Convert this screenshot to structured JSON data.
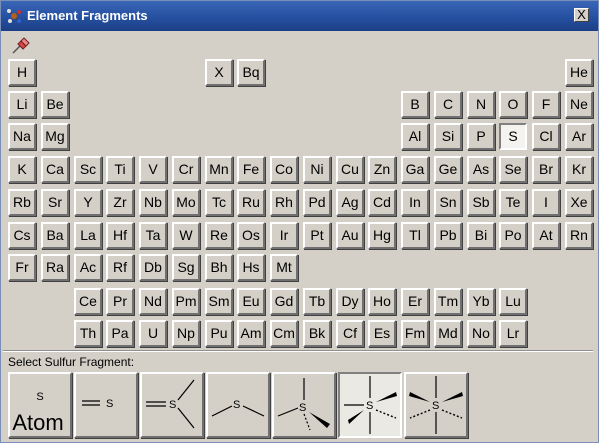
{
  "window": {
    "title": "Element Fragments",
    "close_label": "X"
  },
  "elements": [
    {
      "symbol": "H",
      "row": 0,
      "col": 0
    },
    {
      "symbol": "X",
      "row": 0,
      "col": 6
    },
    {
      "symbol": "Bq",
      "row": 0,
      "col": 7
    },
    {
      "symbol": "He",
      "row": 0,
      "col": 17
    },
    {
      "symbol": "Li",
      "row": 1,
      "col": 0
    },
    {
      "symbol": "Be",
      "row": 1,
      "col": 1
    },
    {
      "symbol": "B",
      "row": 1,
      "col": 12
    },
    {
      "symbol": "C",
      "row": 1,
      "col": 13
    },
    {
      "symbol": "N",
      "row": 1,
      "col": 14
    },
    {
      "symbol": "O",
      "row": 1,
      "col": 15
    },
    {
      "symbol": "F",
      "row": 1,
      "col": 16
    },
    {
      "symbol": "Ne",
      "row": 1,
      "col": 17
    },
    {
      "symbol": "Na",
      "row": 2,
      "col": 0
    },
    {
      "symbol": "Mg",
      "row": 2,
      "col": 1
    },
    {
      "symbol": "Al",
      "row": 2,
      "col": 12
    },
    {
      "symbol": "Si",
      "row": 2,
      "col": 13
    },
    {
      "symbol": "P",
      "row": 2,
      "col": 14
    },
    {
      "symbol": "S",
      "row": 2,
      "col": 15,
      "selected": true
    },
    {
      "symbol": "Cl",
      "row": 2,
      "col": 16
    },
    {
      "symbol": "Ar",
      "row": 2,
      "col": 17
    },
    {
      "symbol": "K",
      "row": 3,
      "col": 0
    },
    {
      "symbol": "Ca",
      "row": 3,
      "col": 1
    },
    {
      "symbol": "Sc",
      "row": 3,
      "col": 2
    },
    {
      "symbol": "Ti",
      "row": 3,
      "col": 3
    },
    {
      "symbol": "V",
      "row": 3,
      "col": 4
    },
    {
      "symbol": "Cr",
      "row": 3,
      "col": 5
    },
    {
      "symbol": "Mn",
      "row": 3,
      "col": 6
    },
    {
      "symbol": "Fe",
      "row": 3,
      "col": 7
    },
    {
      "symbol": "Co",
      "row": 3,
      "col": 8
    },
    {
      "symbol": "Ni",
      "row": 3,
      "col": 9
    },
    {
      "symbol": "Cu",
      "row": 3,
      "col": 10
    },
    {
      "symbol": "Zn",
      "row": 3,
      "col": 11
    },
    {
      "symbol": "Ga",
      "row": 3,
      "col": 12
    },
    {
      "symbol": "Ge",
      "row": 3,
      "col": 13
    },
    {
      "symbol": "As",
      "row": 3,
      "col": 14
    },
    {
      "symbol": "Se",
      "row": 3,
      "col": 15
    },
    {
      "symbol": "Br",
      "row": 3,
      "col": 16
    },
    {
      "symbol": "Kr",
      "row": 3,
      "col": 17
    },
    {
      "symbol": "Rb",
      "row": 4,
      "col": 0
    },
    {
      "symbol": "Sr",
      "row": 4,
      "col": 1
    },
    {
      "symbol": "Y",
      "row": 4,
      "col": 2
    },
    {
      "symbol": "Zr",
      "row": 4,
      "col": 3
    },
    {
      "symbol": "Nb",
      "row": 4,
      "col": 4
    },
    {
      "symbol": "Mo",
      "row": 4,
      "col": 5
    },
    {
      "symbol": "Tc",
      "row": 4,
      "col": 6
    },
    {
      "symbol": "Ru",
      "row": 4,
      "col": 7
    },
    {
      "symbol": "Rh",
      "row": 4,
      "col": 8
    },
    {
      "symbol": "Pd",
      "row": 4,
      "col": 9
    },
    {
      "symbol": "Ag",
      "row": 4,
      "col": 10
    },
    {
      "symbol": "Cd",
      "row": 4,
      "col": 11
    },
    {
      "symbol": "In",
      "row": 4,
      "col": 12
    },
    {
      "symbol": "Sn",
      "row": 4,
      "col": 13
    },
    {
      "symbol": "Sb",
      "row": 4,
      "col": 14
    },
    {
      "symbol": "Te",
      "row": 4,
      "col": 15
    },
    {
      "symbol": "I",
      "row": 4,
      "col": 16
    },
    {
      "symbol": "Xe",
      "row": 4,
      "col": 17
    },
    {
      "symbol": "Cs",
      "row": 5,
      "col": 0
    },
    {
      "symbol": "Ba",
      "row": 5,
      "col": 1
    },
    {
      "symbol": "La",
      "row": 5,
      "col": 2
    },
    {
      "symbol": "Hf",
      "row": 5,
      "col": 3
    },
    {
      "symbol": "Ta",
      "row": 5,
      "col": 4
    },
    {
      "symbol": "W",
      "row": 5,
      "col": 5
    },
    {
      "symbol": "Re",
      "row": 5,
      "col": 6
    },
    {
      "symbol": "Os",
      "row": 5,
      "col": 7
    },
    {
      "symbol": "Ir",
      "row": 5,
      "col": 8
    },
    {
      "symbol": "Pt",
      "row": 5,
      "col": 9
    },
    {
      "symbol": "Au",
      "row": 5,
      "col": 10
    },
    {
      "symbol": "Hg",
      "row": 5,
      "col": 11
    },
    {
      "symbol": "Tl",
      "row": 5,
      "col": 12
    },
    {
      "symbol": "Pb",
      "row": 5,
      "col": 13
    },
    {
      "symbol": "Bi",
      "row": 5,
      "col": 14
    },
    {
      "symbol": "Po",
      "row": 5,
      "col": 15
    },
    {
      "symbol": "At",
      "row": 5,
      "col": 16
    },
    {
      "symbol": "Rn",
      "row": 5,
      "col": 17
    },
    {
      "symbol": "Fr",
      "row": 6,
      "col": 0
    },
    {
      "symbol": "Ra",
      "row": 6,
      "col": 1
    },
    {
      "symbol": "Ac",
      "row": 6,
      "col": 2
    },
    {
      "symbol": "Rf",
      "row": 6,
      "col": 3
    },
    {
      "symbol": "Db",
      "row": 6,
      "col": 4
    },
    {
      "symbol": "Sg",
      "row": 6,
      "col": 5
    },
    {
      "symbol": "Bh",
      "row": 6,
      "col": 6
    },
    {
      "symbol": "Hs",
      "row": 6,
      "col": 7
    },
    {
      "symbol": "Mt",
      "row": 6,
      "col": 8
    },
    {
      "symbol": "Ce",
      "row": 7,
      "col": 2
    },
    {
      "symbol": "Pr",
      "row": 7,
      "col": 3
    },
    {
      "symbol": "Nd",
      "row": 7,
      "col": 4
    },
    {
      "symbol": "Pm",
      "row": 7,
      "col": 5
    },
    {
      "symbol": "Sm",
      "row": 7,
      "col": 6
    },
    {
      "symbol": "Eu",
      "row": 7,
      "col": 7
    },
    {
      "symbol": "Gd",
      "row": 7,
      "col": 8
    },
    {
      "symbol": "Tb",
      "row": 7,
      "col": 9
    },
    {
      "symbol": "Dy",
      "row": 7,
      "col": 10
    },
    {
      "symbol": "Ho",
      "row": 7,
      "col": 11
    },
    {
      "symbol": "Er",
      "row": 7,
      "col": 12
    },
    {
      "symbol": "Tm",
      "row": 7,
      "col": 13
    },
    {
      "symbol": "Yb",
      "row": 7,
      "col": 14
    },
    {
      "symbol": "Lu",
      "row": 7,
      "col": 15
    },
    {
      "symbol": "Th",
      "row": 8,
      "col": 2
    },
    {
      "symbol": "Pa",
      "row": 8,
      "col": 3
    },
    {
      "symbol": "U",
      "row": 8,
      "col": 4
    },
    {
      "symbol": "Np",
      "row": 8,
      "col": 5
    },
    {
      "symbol": "Pu",
      "row": 8,
      "col": 6
    },
    {
      "symbol": "Am",
      "row": 8,
      "col": 7
    },
    {
      "symbol": "Cm",
      "row": 8,
      "col": 8
    },
    {
      "symbol": "Bk",
      "row": 8,
      "col": 9
    },
    {
      "symbol": "Cf",
      "row": 8,
      "col": 10
    },
    {
      "symbol": "Es",
      "row": 8,
      "col": 11
    },
    {
      "symbol": "Fm",
      "row": 8,
      "col": 12
    },
    {
      "symbol": "Md",
      "row": 8,
      "col": 13
    },
    {
      "symbol": "No",
      "row": 8,
      "col": 14
    },
    {
      "symbol": "Lr",
      "row": 8,
      "col": 15
    }
  ],
  "fragment_panel": {
    "label": "Select Sulfur Fragment:",
    "atom_symbol": "S",
    "atom_label": "Atom",
    "fragments": [
      {
        "name": "fragment-atom",
        "selected": false
      },
      {
        "name": "fragment-double-bond",
        "atom": "S",
        "selected": false
      },
      {
        "name": "fragment-double-bond-two-bonds",
        "atom": "S",
        "selected": false
      },
      {
        "name": "fragment-two-bonds",
        "atom": "S",
        "selected": false
      },
      {
        "name": "fragment-pyramidal-three-bonds",
        "atom": "S",
        "selected": false
      },
      {
        "name": "fragment-octahedral",
        "atom": "S",
        "selected": true
      },
      {
        "name": "fragment-octahedral-wedged",
        "atom": "S",
        "selected": false
      }
    ]
  },
  "icons": {
    "app": "molecule-icon",
    "pin": "pushpin-icon",
    "close": "close-icon"
  }
}
